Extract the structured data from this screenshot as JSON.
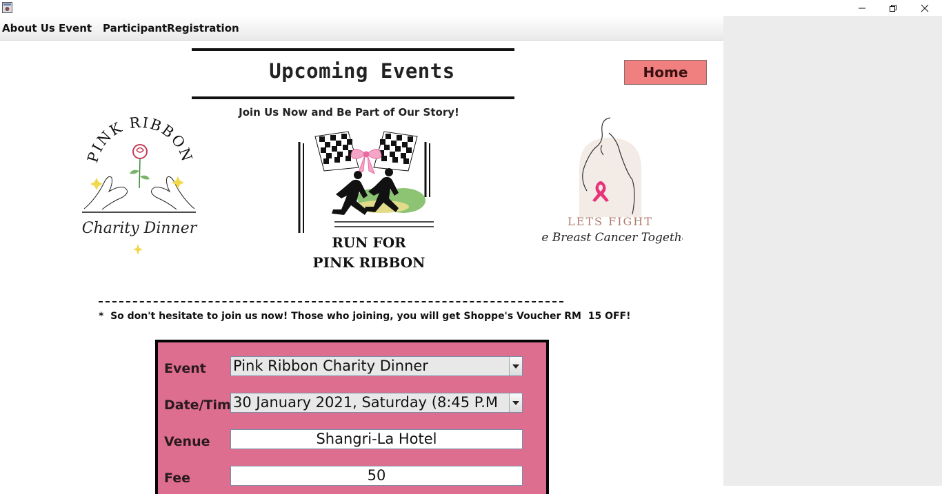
{
  "menu": {
    "items": [
      "About Us",
      "Event",
      "ParticipantRegistration"
    ]
  },
  "header": {
    "title": "Upcoming Events",
    "home_label": "Home",
    "tagline": "Join Us Now and Be Part of Our Story!"
  },
  "logos": {
    "charity": {
      "top": "PINK RIBBON",
      "bottom": "Charity Dinner"
    },
    "run": {
      "line1": "RUN FOR",
      "line2": "PINK RIBBON"
    },
    "fight": {
      "line1": "LETS FIGHT",
      "line2": "The Breast Cancer Together"
    }
  },
  "promo": {
    "note": "*  So don't hesitate to join us now! Those who joining, you will get Shoppe's Voucher RM  15 OFF!"
  },
  "form": {
    "event_label": "Event",
    "event_value": "Pink Ribbon Charity Dinner",
    "datetime_label": "Date/Time",
    "datetime_value": "30 January 2021, Saturday (8:45 P.M",
    "venue_label": "Venue",
    "venue_value": "Shangri-La Hotel",
    "fee_label": "Fee",
    "fee_value": "50"
  },
  "colors": {
    "form_bg": "#dd6e8f",
    "home_button": "#f08080",
    "ribbon_pink": "#e8337a"
  },
  "icons": [
    "app-icon",
    "minimize-icon",
    "maximize-icon",
    "close-icon",
    "chevron-down-icon"
  ]
}
